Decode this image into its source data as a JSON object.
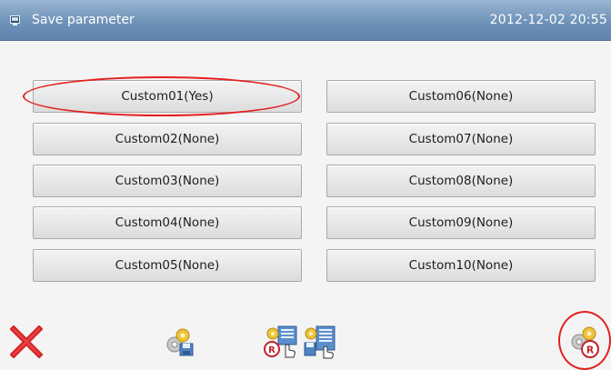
{
  "header": {
    "title": "Save parameter",
    "clock": "2012-12-02  20:55"
  },
  "slots": [
    {
      "label": "Custom01(Yes)"
    },
    {
      "label": "Custom02(None)"
    },
    {
      "label": "Custom03(None)"
    },
    {
      "label": "Custom04(None)"
    },
    {
      "label": "Custom05(None)"
    },
    {
      "label": "Custom06(None)"
    },
    {
      "label": "Custom07(None)"
    },
    {
      "label": "Custom08(None)"
    },
    {
      "label": "Custom09(None)"
    },
    {
      "label": "Custom10(None)"
    }
  ],
  "toolbar": {
    "icons": [
      "close-icon",
      "gear-save-icon",
      "gear-restore-select-icon",
      "gear-list-select-icon",
      "gear-restore-icon"
    ]
  },
  "colors": {
    "titlebar": "#6e92b8",
    "highlight": "#e41f1f",
    "close": "#d8262a"
  }
}
